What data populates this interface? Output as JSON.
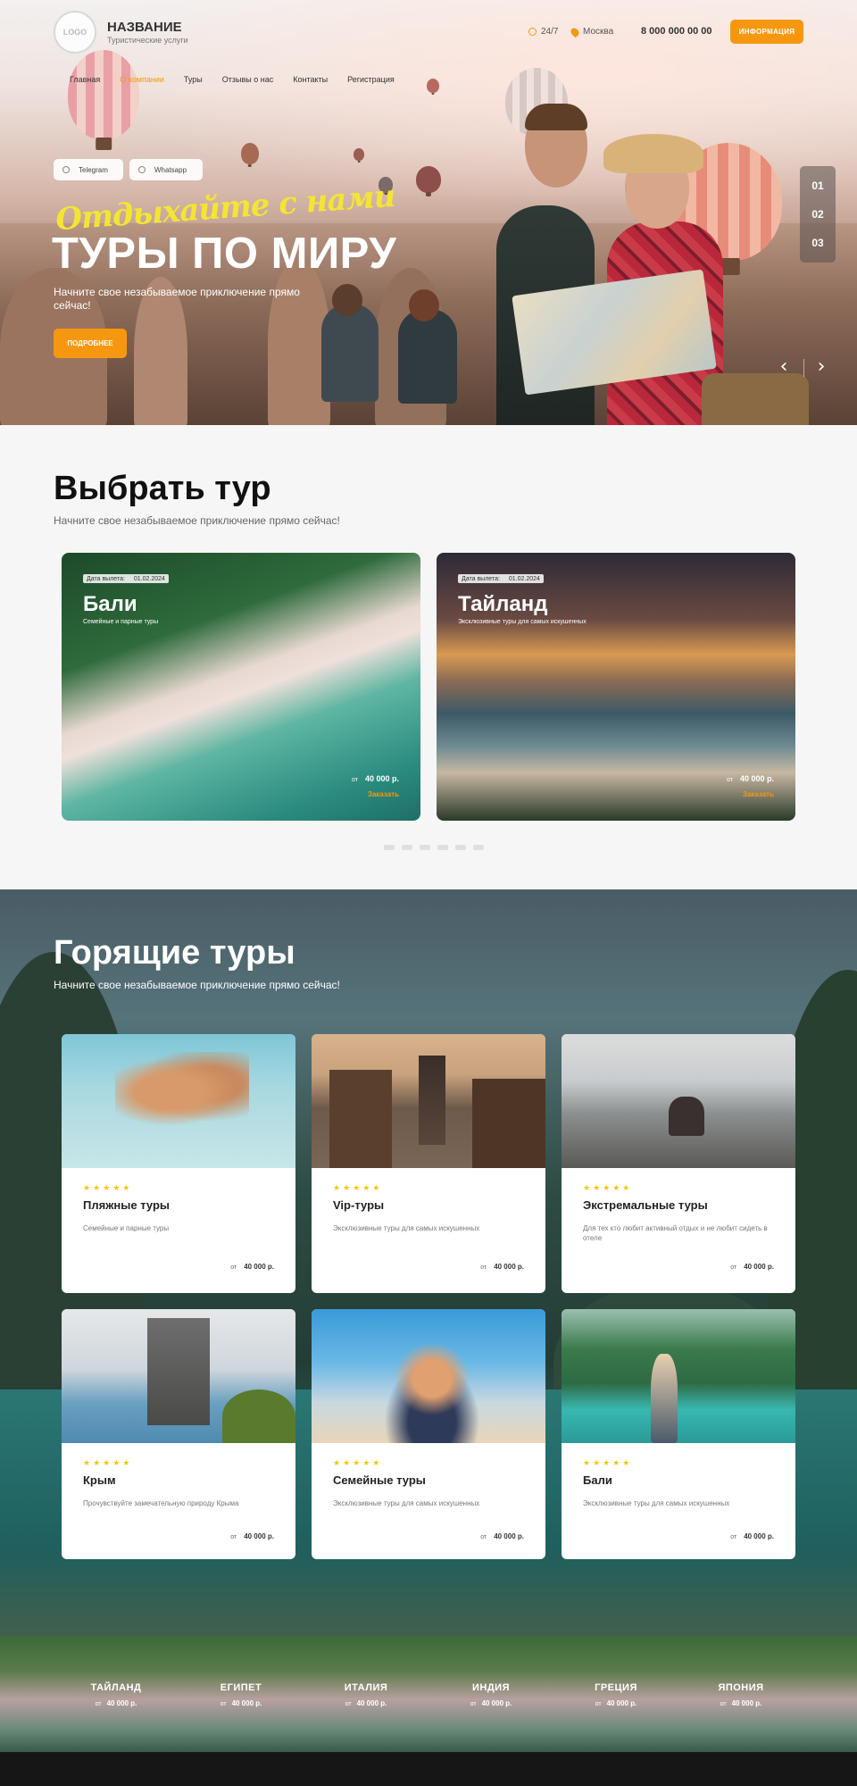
{
  "header": {
    "logo_text": "LOGO",
    "brand_name": "НАЗВАНИЕ",
    "brand_sub": "Туристические услуги",
    "hours": "24/7",
    "city": "Москва",
    "phone": "8 000 000 00 00",
    "info_button": "ИНФОРМАЦИЯ",
    "nav": [
      "Главная",
      "О компании",
      "Туры",
      "Отзывы о нас",
      "Контакты",
      "Регистрация"
    ],
    "nav_active": "О компании"
  },
  "hero": {
    "telegram": "Telegram",
    "whatsapp": "Whatsapp",
    "slogan": "Отдыхайте с нами",
    "title": "ТУРЫ ПО МИРУ",
    "description": "Начните свое незабываемое приключение прямо сейчас!",
    "more_button": "ПОДРОБНЕЕ",
    "slides": [
      "01",
      "02",
      "03"
    ],
    "prev_icon": "chevron-left-icon",
    "next_icon": "chevron-right-icon"
  },
  "choose": {
    "title": "Выбрать тур",
    "subtitle": "Начните свое незабываемое приключение прямо сейчас!",
    "cards": [
      {
        "date_label": "Дата вылета:",
        "date": "01.02.2024",
        "name": "Бали",
        "sub": "Семейные и парные туры",
        "price_prefix": "от",
        "price": "40 000 р.",
        "order": "Заказать"
      },
      {
        "date_label": "Дата вылета:",
        "date": "01.02.2024",
        "name": "Тайланд",
        "sub": "Эксклюзивные туры для самых искушенных",
        "price_prefix": "от",
        "price": "40 000 р.",
        "order": "Заказать"
      }
    ],
    "dots_count": 6
  },
  "hot": {
    "title": "Горящие туры",
    "subtitle": "Начните свое незабываемое приключение прямо сейчас!",
    "stars": "★★★★★",
    "cards": [
      {
        "name": "Пляжные туры",
        "desc": "Семейные и парные туры",
        "price_prefix": "от",
        "price": "40 000 р."
      },
      {
        "name": "Vip-туры",
        "desc": "Эксклюзивные туры для самых искушенных",
        "price_prefix": "от",
        "price": "40 000 р."
      },
      {
        "name": "Экстремальные туры",
        "desc": "Для тех кто любит активный отдых и не любит сидеть в отеле",
        "price_prefix": "от",
        "price": "40 000 р."
      },
      {
        "name": "Крым",
        "desc": "Прочувствуйте замечательную природу Крыма",
        "price_prefix": "от",
        "price": "40 000 р."
      },
      {
        "name": "Семейные туры",
        "desc": "Эксклюзивные туры для самых искушенных",
        "price_prefix": "от",
        "price": "40 000 р."
      },
      {
        "name": "Бали",
        "desc": "Эксклюзивные туры для самых искушенных",
        "price_prefix": "от",
        "price": "40 000 р."
      }
    ]
  },
  "countries": [
    {
      "name": "ТАЙЛАНД",
      "price_prefix": "от",
      "price": "40 000 р."
    },
    {
      "name": "ЕГИПЕТ",
      "price_prefix": "от",
      "price": "40 000 р."
    },
    {
      "name": "ИТАЛИЯ",
      "price_prefix": "от",
      "price": "40 000 р."
    },
    {
      "name": "ИНДИЯ",
      "price_prefix": "от",
      "price": "40 000 р."
    },
    {
      "name": "ГРЕЦИЯ",
      "price_prefix": "от",
      "price": "40 000 р."
    },
    {
      "name": "ЯПОНИЯ",
      "price_prefix": "от",
      "price": "40 000 р."
    }
  ],
  "colors": {
    "accent": "#f6980f",
    "slogan": "#f4e532",
    "stars": "#f0c808",
    "footer": "#161616"
  }
}
